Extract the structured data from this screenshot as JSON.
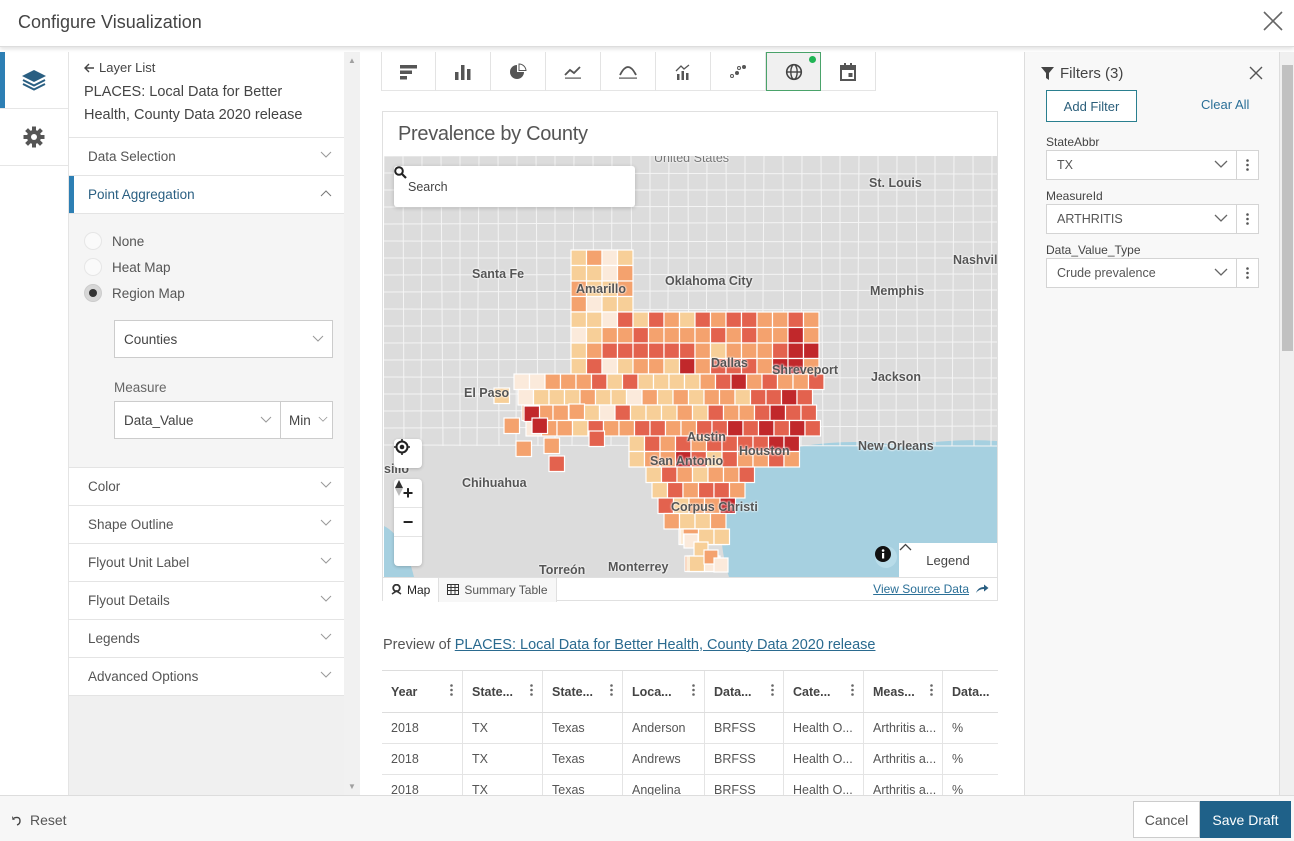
{
  "dialog": {
    "title": "Configure Visualization"
  },
  "rail": {
    "items": [
      {
        "icon": "layers-icon",
        "active": true
      },
      {
        "icon": "gear-icon",
        "active": false
      }
    ]
  },
  "config": {
    "back_label": "Layer List",
    "dataset_title": "PLACES: Local Data for Better Health, County Data 2020 release",
    "sections": {
      "data_selection": "Data Selection",
      "point_aggregation": "Point Aggregation",
      "color": "Color",
      "shape_outline": "Shape Outline",
      "flyout_unit_label": "Flyout Unit Label",
      "flyout_details": "Flyout Details",
      "legends": "Legends",
      "advanced_options": "Advanced Options"
    },
    "aggregation_options": [
      {
        "label": "None",
        "checked": false
      },
      {
        "label": "Heat Map",
        "checked": false
      },
      {
        "label": "Region Map",
        "checked": true
      }
    ],
    "region_select": "Counties",
    "measure_label": "Measure",
    "measure_field": "Data_Value",
    "measure_agg": "Min"
  },
  "viz_types": [
    {
      "name": "barchart-icon",
      "active": false
    },
    {
      "name": "columnchart-icon",
      "active": false
    },
    {
      "name": "piechart-icon",
      "active": false
    },
    {
      "name": "timeline-icon",
      "active": false
    },
    {
      "name": "histogram-icon",
      "active": false
    },
    {
      "name": "combochart-icon",
      "active": false
    },
    {
      "name": "scatterplot-icon",
      "active": false
    },
    {
      "name": "map-icon",
      "active": true
    },
    {
      "name": "calendar-icon",
      "active": false
    }
  ],
  "viz": {
    "title": "Prevalence by County",
    "search_placeholder": "Search",
    "map_labels": {
      "united_states": "United States",
      "st_louis": "St. Louis",
      "santa_fe": "Santa Fe",
      "amarillo": "Amarillo",
      "oklahoma_city": "Oklahoma City",
      "memphis": "Memphis",
      "nashville": "Nashvil",
      "dallas": "Dallas",
      "shreveport": "Shreveport",
      "jackson": "Jackson",
      "el_paso": "El Paso",
      "austin": "Austin",
      "san_antonio": "San Antonio",
      "houston": "Houston",
      "new_orleans": "New Orleans",
      "chihuahua": "Chihuahua",
      "silio": "silio",
      "corpus_christi": "Corpus Christi",
      "torreon": "Torreón",
      "monterrey": "Monterrey"
    },
    "legend_label": "Legend",
    "tabs": {
      "map": "Map",
      "summary_table": "Summary Table"
    },
    "view_source": "View Source Data",
    "colors": {
      "c1": "#fbeadb",
      "c2": "#f7cf98",
      "c3": "#f4a26e",
      "c4": "#e3624e",
      "c5": "#c1282b",
      "land": "#dcdcdc",
      "water": "#a6d0e0"
    }
  },
  "preview": {
    "prefix": "Preview of ",
    "link": "PLACES: Local Data for Better Health, County Data 2020 release"
  },
  "table": {
    "columns": [
      "Year",
      "State...",
      "State...",
      "Loca...",
      "Data...",
      "Cate...",
      "Meas...",
      "Data..."
    ],
    "rows": [
      [
        "2018",
        "TX",
        "Texas",
        "Anderson",
        "BRFSS",
        "Health O...",
        "Arthritis a...",
        "%"
      ],
      [
        "2018",
        "TX",
        "Texas",
        "Andrews",
        "BRFSS",
        "Health O...",
        "Arthritis a...",
        "%"
      ],
      [
        "2018",
        "TX",
        "Texas",
        "Angelina",
        "BRFSS",
        "Health O...",
        "Arthritis a...",
        "%"
      ]
    ]
  },
  "filters": {
    "title": "Filters (3)",
    "add_label": "Add Filter",
    "clear_label": "Clear All",
    "items": [
      {
        "label": "StateAbbr",
        "value": "TX"
      },
      {
        "label": "MeasureId",
        "value": "ARTHRITIS"
      },
      {
        "label": "Data_Value_Type",
        "value": "Crude prevalence"
      }
    ]
  },
  "footer": {
    "reset": "Reset",
    "cancel": "Cancel",
    "save": "Save Draft"
  }
}
